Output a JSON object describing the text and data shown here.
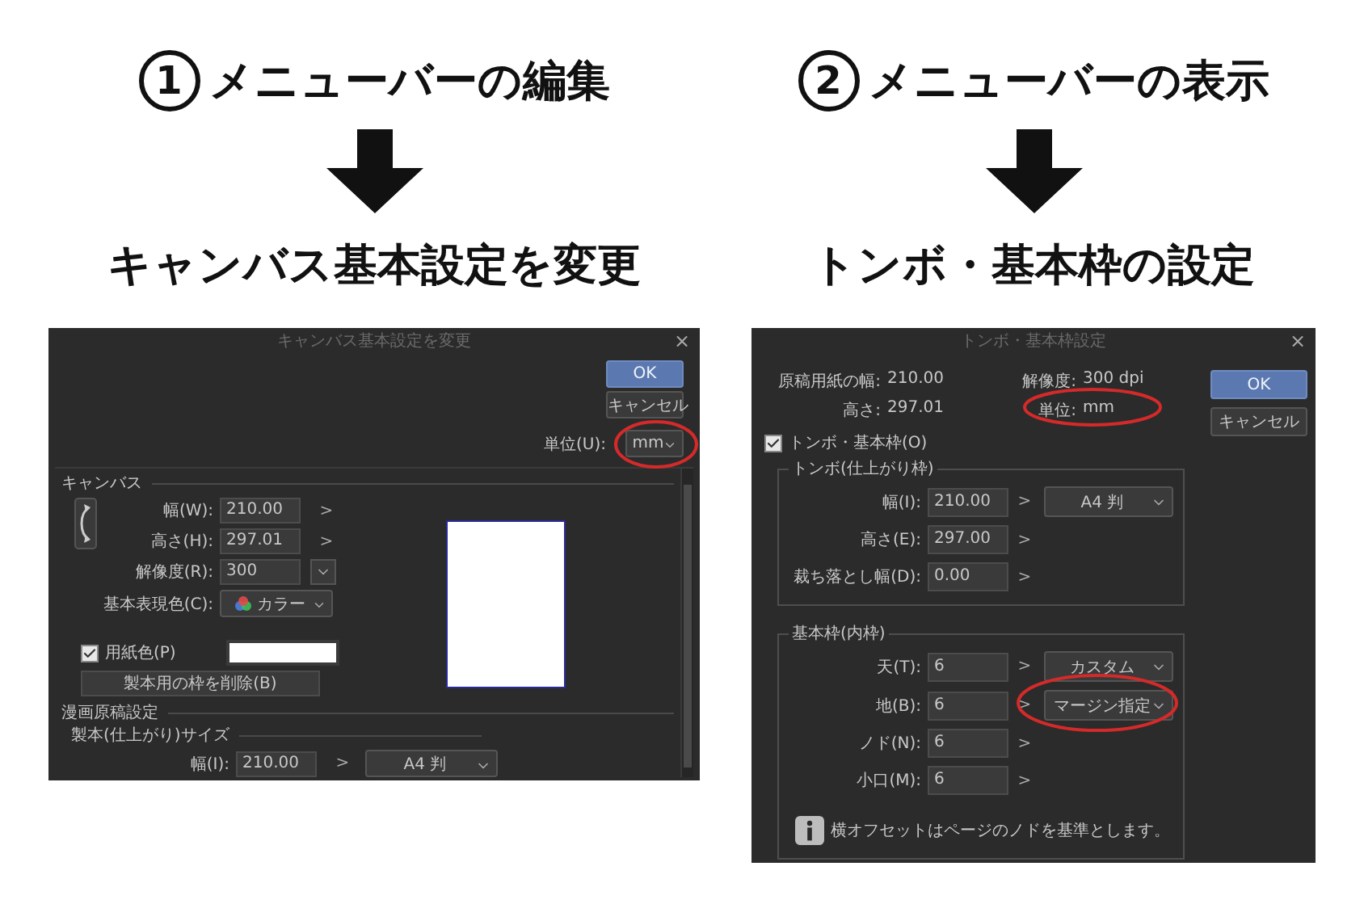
{
  "steps": [
    {
      "number": "1",
      "heading": "メニューバーの編集",
      "caption": "キャンバス基本設定を変更",
      "dialog": {
        "kind": "canvas",
        "title": "キャンバス基本設定を変更",
        "close": "×",
        "ok": "OK",
        "cancel": "キャンセル",
        "unit_label": "単位(U):",
        "unit_value": "mm",
        "section": "キャンバス",
        "fields": [
          {
            "label": "幅(W):",
            "value": "210.00",
            "action": ">"
          },
          {
            "label": "高さ(H):",
            "value": "297.01",
            "action": ">"
          },
          {
            "label": "解像度(R):",
            "value": "300"
          }
        ],
        "color_label": "基本表現色(C):",
        "color_value": "カラー",
        "paper_color": {
          "label": "用紙色(P)",
          "checked": true
        },
        "remove_button": "製本用の枠を削除(B)",
        "comic_section": "漫画原稿設定",
        "binding_section": "製本(仕上がり)サイズ",
        "binding_field": {
          "label": "幅(I):",
          "value": "210.00",
          "action": ">",
          "preset": "A4 判"
        }
      }
    },
    {
      "number": "2",
      "heading": "メニューバーの表示",
      "caption": "トンボ・基本枠の設定",
      "dialog": {
        "kind": "crop_marks",
        "title": "トンボ・基本枠設定",
        "close": "×",
        "ok": "OK",
        "cancel": "キャンセル",
        "info": [
          {
            "label": "原稿用紙の幅:",
            "value": "210.00"
          },
          {
            "label": "高さ:",
            "value": "297.01"
          }
        ],
        "info_right": [
          {
            "label": "解像度:",
            "value": "300 dpi"
          },
          {
            "label": "単位:",
            "value": "mm"
          }
        ],
        "crop_marks": {
          "label": "トンボ・基本枠(O)",
          "checked": true
        },
        "groups": [
          {
            "title": "トンボ(仕上がり枠)",
            "rows": [
              {
                "label": "幅(I):",
                "value": "210.00",
                "action": ">",
                "preset": "A4 判"
              },
              {
                "label": "高さ(E):",
                "value": "297.00",
                "action": ">"
              },
              {
                "label": "裁ち落とし幅(D):",
                "value": "0.00",
                "action": ">"
              }
            ]
          },
          {
            "title": "基本枠(内枠)",
            "rows": [
              {
                "label": "天(T):",
                "value": "6",
                "action": ">",
                "preset": "カスタム"
              },
              {
                "label": "地(B):",
                "value": "6",
                "action": ">",
                "preset": "マージン指定"
              },
              {
                "label": "ノド(N):",
                "value": "6",
                "action": ">"
              },
              {
                "label": "小口(M):",
                "value": "6",
                "action": ">"
              }
            ],
            "note": "横オフセットはページのノドを基準とします。"
          }
        ]
      }
    }
  ]
}
